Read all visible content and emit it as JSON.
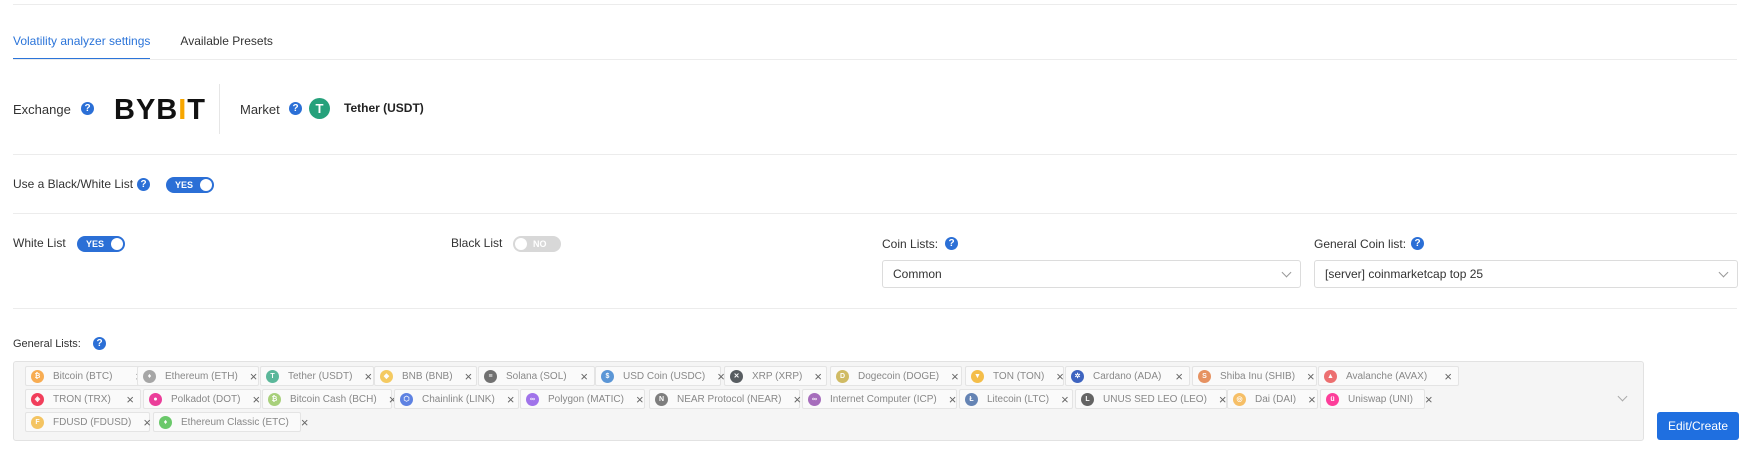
{
  "tabs": [
    {
      "label": "Volatility analyzer settings",
      "active": true
    },
    {
      "label": "Available Presets",
      "active": false
    }
  ],
  "exchange": {
    "label": "Exchange",
    "logo_text_a": "BYB",
    "logo_text_b": "I",
    "logo_text_c": "T"
  },
  "market": {
    "label": "Market",
    "icon_glyph": "T",
    "value": "Tether (USDT)"
  },
  "bw_list": {
    "label": "Use a Black/White List",
    "toggle_label": "YES"
  },
  "white_list": {
    "label": "White List",
    "toggle_label": "YES"
  },
  "black_list": {
    "label": "Black List",
    "toggle_label": "NO"
  },
  "coin_lists": {
    "label": "Coin Lists:",
    "value": "Common"
  },
  "general_coin_list": {
    "label": "General Coin list:",
    "value": "[server] coinmarketcap top 25"
  },
  "general_lists": {
    "label": "General Lists:",
    "coins": [
      {
        "name": "Bitcoin (BTC)",
        "color": "#f7931a",
        "glyph": "₿"
      },
      {
        "name": "Ethereum (ETH)",
        "color": "#8a8a8a",
        "glyph": "♦"
      },
      {
        "name": "Tether (USDT)",
        "color": "#26a17b",
        "glyph": "T"
      },
      {
        "name": "BNB (BNB)",
        "color": "#f3ba2f",
        "glyph": "◆"
      },
      {
        "name": "Solana (SOL)",
        "color": "#444444",
        "glyph": "≡"
      },
      {
        "name": "USD Coin (USDC)",
        "color": "#2775ca",
        "glyph": "$"
      },
      {
        "name": "XRP (XRP)",
        "color": "#23292f",
        "glyph": "✕"
      },
      {
        "name": "Dogecoin (DOGE)",
        "color": "#c2a633",
        "glyph": "D"
      },
      {
        "name": "TON (TON)",
        "color": "#f2a90f",
        "glyph": "▼"
      },
      {
        "name": "Cardano (ADA)",
        "color": "#0033ad",
        "glyph": "✲"
      },
      {
        "name": "Shiba Inu (SHIB)",
        "color": "#e0702f",
        "glyph": "S"
      },
      {
        "name": "Avalanche (AVAX)",
        "color": "#e84142",
        "glyph": "▲"
      },
      {
        "name": "TRON (TRX)",
        "color": "#ef0027",
        "glyph": "◈"
      },
      {
        "name": "Polkadot (DOT)",
        "color": "#e6007a",
        "glyph": "●"
      },
      {
        "name": "Bitcoin Cash (BCH)",
        "color": "#8dc351",
        "glyph": "₿"
      },
      {
        "name": "Chainlink (LINK)",
        "color": "#2a5ada",
        "glyph": "⬡"
      },
      {
        "name": "Polygon (MATIC)",
        "color": "#8247e5",
        "glyph": "∞"
      },
      {
        "name": "NEAR Protocol (NEAR)",
        "color": "#555555",
        "glyph": "N"
      },
      {
        "name": "Internet Computer (ICP)",
        "color": "#8b3fa8",
        "glyph": "∞"
      },
      {
        "name": "Litecoin (LTC)",
        "color": "#345d9d",
        "glyph": "Ł"
      },
      {
        "name": "UNUS SED LEO (LEO)",
        "color": "#333333",
        "glyph": "L"
      },
      {
        "name": "Dai (DAI)",
        "color": "#f5ac37",
        "glyph": "◎"
      },
      {
        "name": "Uniswap (UNI)",
        "color": "#ff007a",
        "glyph": "ü"
      },
      {
        "name": "FDUSD (FDUSD)",
        "color": "#f2b230",
        "glyph": "F"
      },
      {
        "name": "Ethereum Classic (ETC)",
        "color": "#3ab83a",
        "glyph": "♦"
      }
    ]
  },
  "edit_button": {
    "label": "Edit/Create"
  },
  "colors": {
    "accent": "#2b6fd6",
    "button": "#1f6fe0",
    "tether": "#26a17b",
    "bybit_bar": "#f7a600"
  }
}
